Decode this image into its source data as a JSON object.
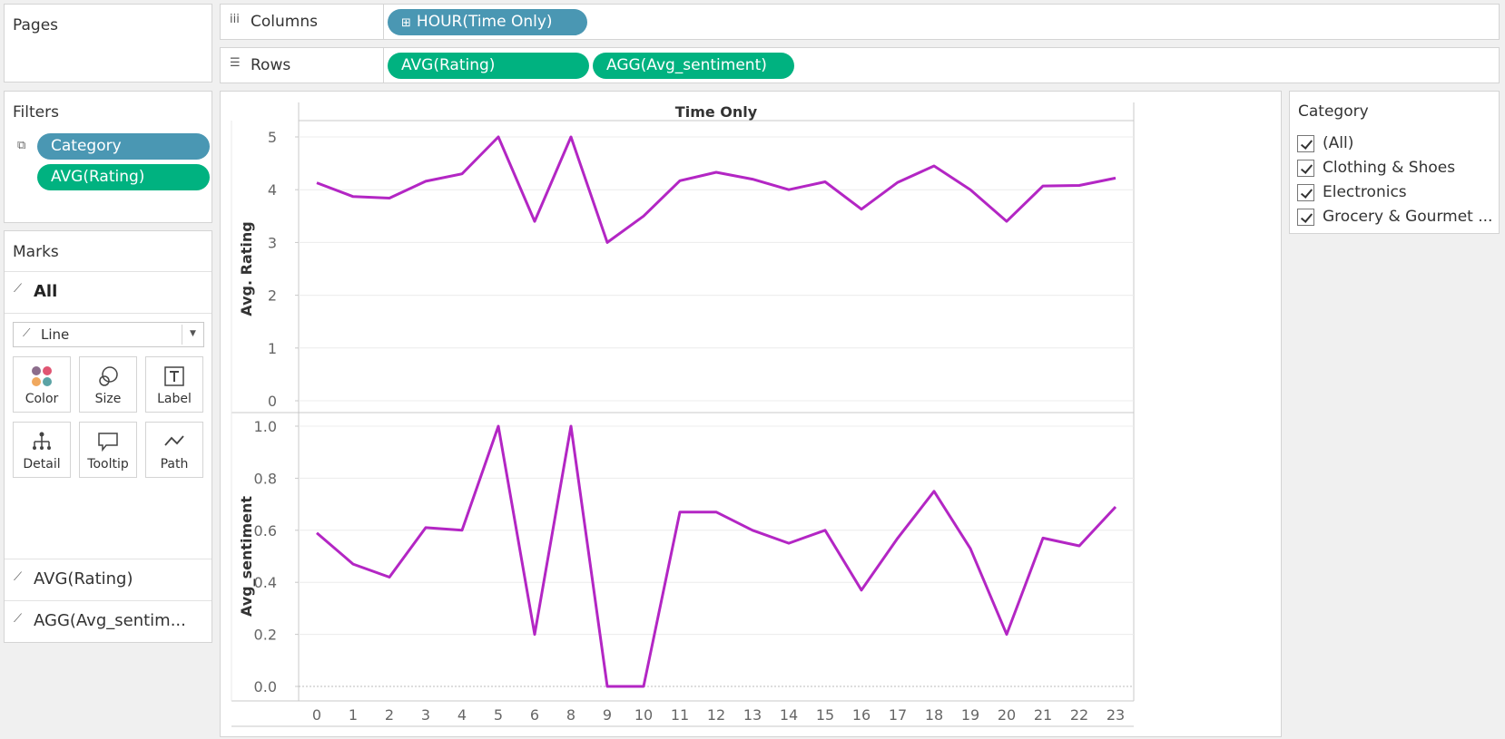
{
  "pages_panel": {
    "title": "Pages"
  },
  "columns_shelf": {
    "label": "Columns",
    "pills": [
      "HOUR(Time Only)"
    ]
  },
  "rows_shelf": {
    "label": "Rows",
    "pills": [
      "AVG(Rating)",
      "AGG(Avg_sentiment)"
    ]
  },
  "filters_panel": {
    "title": "Filters",
    "pills": [
      "Category",
      "AVG(Rating)"
    ]
  },
  "marks_panel": {
    "title": "Marks",
    "all_label": "All",
    "mark_type": "Line",
    "cards": [
      "Color",
      "Size",
      "Label",
      "Detail",
      "Tooltip",
      "Path"
    ],
    "measures": [
      "AVG(Rating)",
      "AGG(Avg_sentim..."
    ]
  },
  "category_filter": {
    "title": "Category",
    "items": [
      "(All)",
      "Clothing & Shoes",
      "Electronics",
      "Grocery & Gourmet ..."
    ]
  },
  "colors": {
    "line": "#b326c4",
    "pill_blue": "#4a97b3",
    "pill_green": "#00b280"
  },
  "chart_data": {
    "type": "line",
    "title": "Time Only",
    "x": [
      0,
      1,
      2,
      3,
      4,
      5,
      6,
      8,
      9,
      10,
      11,
      12,
      13,
      14,
      15,
      16,
      17,
      18,
      19,
      20,
      21,
      22,
      23
    ],
    "panes": [
      {
        "name": "Avg. Rating",
        "ylabel": "Avg. Rating",
        "ylim": [
          0,
          5
        ],
        "yticks": [
          "0",
          "1",
          "2",
          "3",
          "4",
          "5"
        ],
        "values": [
          4.13,
          3.87,
          3.84,
          4.16,
          4.3,
          5.0,
          3.4,
          5.0,
          3.0,
          3.5,
          4.17,
          4.33,
          4.2,
          4.0,
          4.15,
          3.63,
          4.14,
          4.45,
          4.0,
          3.4,
          4.07,
          4.08,
          4.22
        ]
      },
      {
        "name": "Avg_sentiment",
        "ylabel": "Avg_sentiment",
        "ylim": [
          0,
          1
        ],
        "yticks": [
          "0.0",
          "0.2",
          "0.4",
          "0.6",
          "0.8",
          "1.0"
        ],
        "values": [
          0.59,
          0.47,
          0.42,
          0.61,
          0.6,
          1.0,
          0.2,
          1.0,
          0.0,
          0.0,
          0.67,
          0.67,
          0.6,
          0.55,
          0.6,
          0.37,
          0.57,
          0.75,
          0.53,
          0.2,
          0.57,
          0.54,
          0.69
        ]
      }
    ],
    "xticks": [
      "0",
      "1",
      "2",
      "3",
      "4",
      "5",
      "6",
      "8",
      "9",
      "10",
      "11",
      "12",
      "13",
      "14",
      "15",
      "16",
      "17",
      "18",
      "19",
      "20",
      "21",
      "22",
      "23"
    ],
    "grid": true,
    "legend": "none"
  }
}
